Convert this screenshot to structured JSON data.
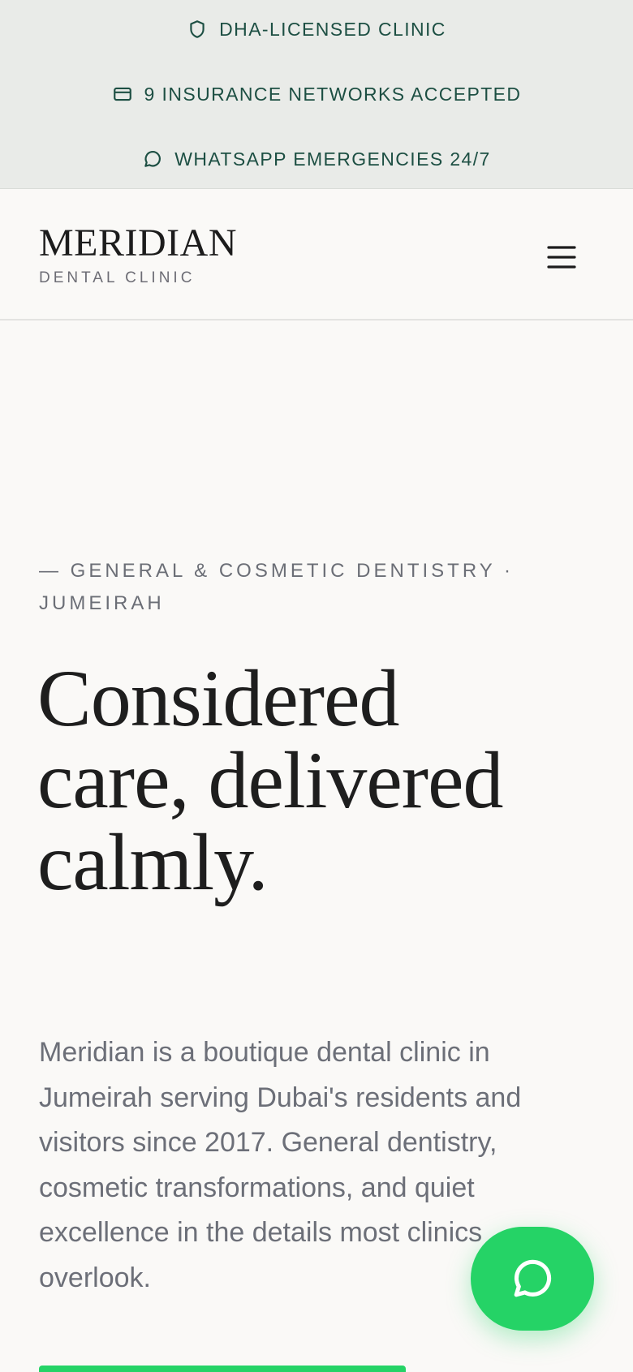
{
  "trust_bar": {
    "items": [
      {
        "icon": "shield-icon",
        "label": "DHA-LICENSED CLINIC"
      },
      {
        "icon": "card-icon",
        "label": "9 INSURANCE NETWORKS ACCEPTED"
      },
      {
        "icon": "chat-bubble-icon",
        "label": "WHATSAPP EMERGENCIES 24/7"
      }
    ]
  },
  "header": {
    "logo_title": "MERIDIAN",
    "logo_subtitle": "DENTAL CLINIC",
    "menu_icon": "hamburger-menu-icon"
  },
  "hero": {
    "eyebrow": "— GENERAL & COSMETIC DENTISTRY · JUMEIRAH",
    "headline": "Considered care, delivered calmly.",
    "intro": "Meridian is a boutique dental clinic in Jumeirah serving Dubai's residents and visitors since 2017. General dentistry, cosmetic transformations, and quiet excellence in the details most clinics overlook."
  },
  "floating": {
    "whatsapp_icon": "whatsapp-chat-icon"
  },
  "colors": {
    "trust_bar_bg": "#e9ebe8",
    "trust_text": "#1d4f43",
    "page_bg": "#faf9f7",
    "headline": "#1e1e1e",
    "body_text": "#6c6f78",
    "whatsapp_green": "#25d366"
  }
}
